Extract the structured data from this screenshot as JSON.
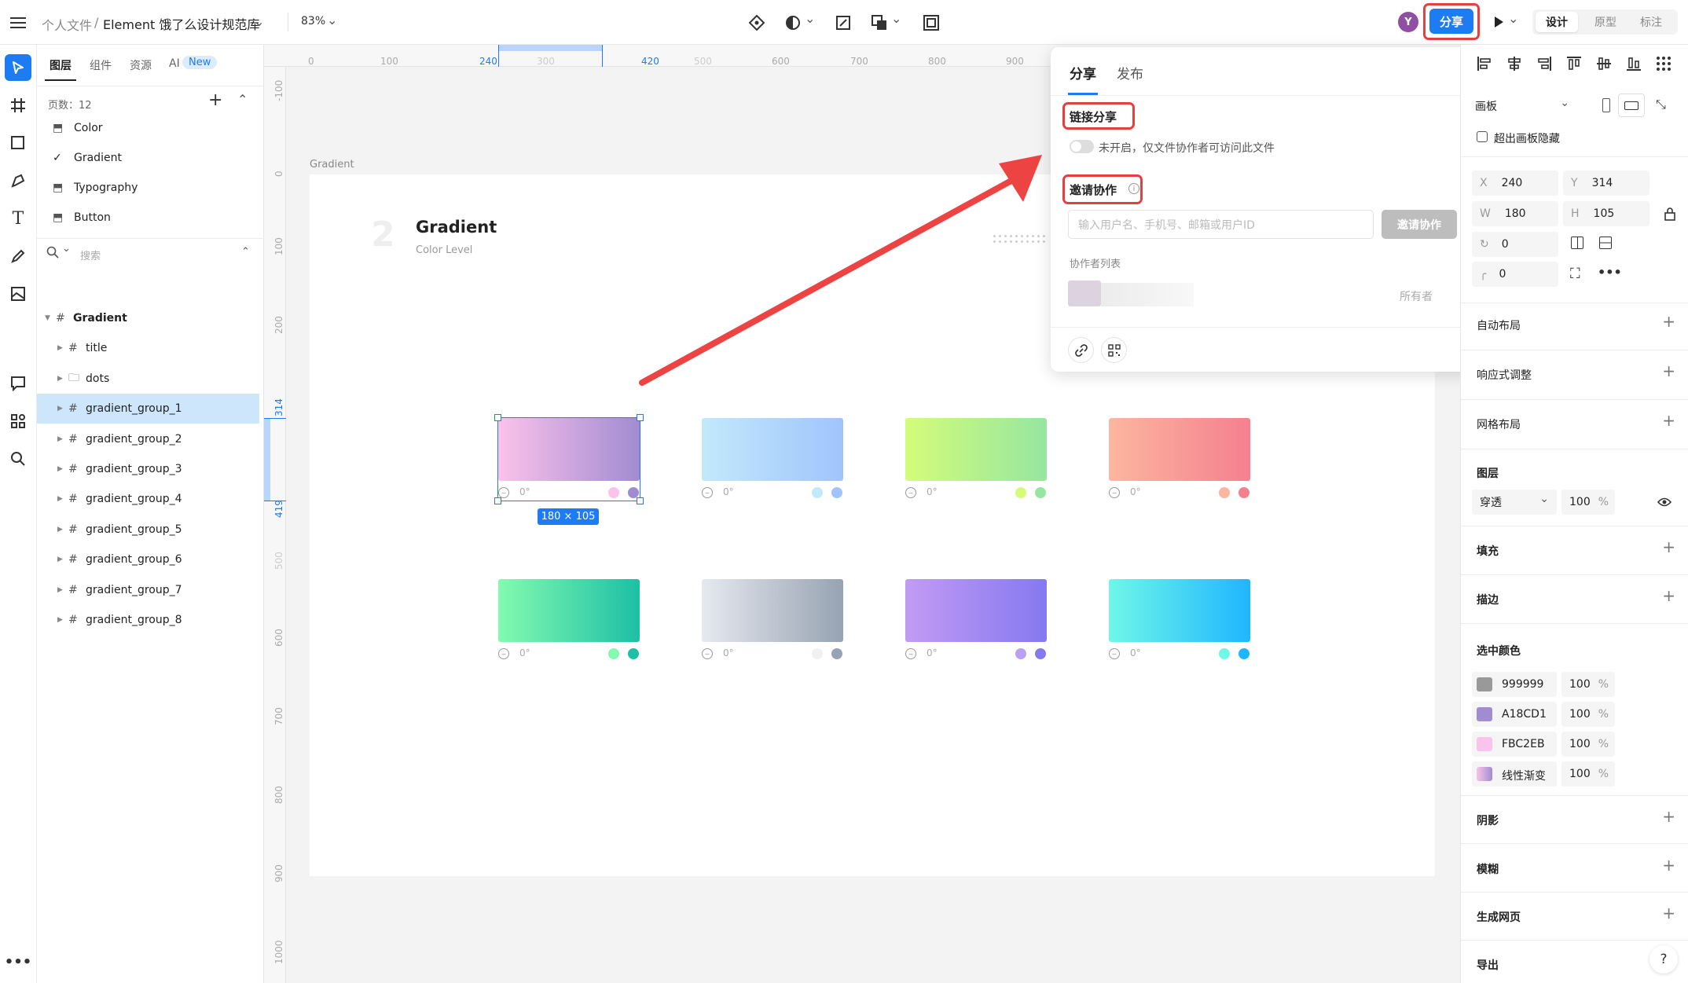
{
  "topbar": {
    "menu_icon": "menu-icon",
    "breadcrumb_parent": "个人文件",
    "breadcrumb_sep": "/",
    "file_name": "Element 饿了么设计规范库",
    "zoom": "83%",
    "avatar_letter": "Y",
    "share_label": "分享",
    "modes": [
      "设计",
      "原型",
      "标注"
    ]
  },
  "layers_panel": {
    "tabs": [
      "图层",
      "组件",
      "资源",
      "AI"
    ],
    "ai_badge": "New",
    "page_count": "页数：12",
    "pages": [
      "Color",
      "Gradient",
      "Typography",
      "Button"
    ],
    "current_page": "Gradient",
    "search_placeholder": "搜索",
    "tree": [
      {
        "name": "Gradient",
        "level": 0,
        "type": "frame"
      },
      {
        "name": "title",
        "level": 1,
        "type": "frame"
      },
      {
        "name": "dots",
        "level": 1,
        "type": "folder"
      },
      {
        "name": "gradient_group_1",
        "level": 1,
        "type": "frame",
        "selected": true
      },
      {
        "name": "gradient_group_2",
        "level": 1,
        "type": "frame"
      },
      {
        "name": "gradient_group_3",
        "level": 1,
        "type": "frame"
      },
      {
        "name": "gradient_group_4",
        "level": 1,
        "type": "frame"
      },
      {
        "name": "gradient_group_5",
        "level": 1,
        "type": "frame"
      },
      {
        "name": "gradient_group_6",
        "level": 1,
        "type": "frame"
      },
      {
        "name": "gradient_group_7",
        "level": 1,
        "type": "frame"
      },
      {
        "name": "gradient_group_8",
        "level": 1,
        "type": "frame"
      }
    ]
  },
  "canvas": {
    "h_ruler": [
      "0",
      "100",
      "240",
      "300",
      "420",
      "500",
      "600",
      "700",
      "800",
      "900"
    ],
    "v_ruler": [
      "-100",
      "0",
      "100",
      "200",
      "314",
      "419",
      "500",
      "600",
      "700",
      "800",
      "900",
      "1000"
    ],
    "frame_label": "Gradient",
    "section_number": "2",
    "section_title": "Gradient",
    "section_subtitle": "Color Level",
    "selection_size": "180 × 105",
    "degree": "0°",
    "gradients": [
      {
        "from": "#FBC2EB",
        "to": "#A18CD1",
        "dot1": "#FBC2EB",
        "dot2": "#A18CD1"
      },
      {
        "from": "#C2E9FB",
        "to": "#A1C4FD",
        "dot1": "#C2E9FB",
        "dot2": "#A1C4FD"
      },
      {
        "from": "#D4FC79",
        "to": "#96E6A1",
        "dot1": "#D4FC79",
        "dot2": "#96E6A1"
      },
      {
        "from": "#FCB69F",
        "to": "#F5808F",
        "dot1": "#FCB69F",
        "dot2": "#F5808F"
      },
      {
        "from": "#84FAB0",
        "to": "#1DBFA6",
        "dot1": "#84FAB0",
        "dot2": "#1DBFA6"
      },
      {
        "from": "#E6E9F0",
        "to": "#97A3B2",
        "dot1": "#F0F0F0",
        "dot2": "#97A3B2"
      },
      {
        "from": "#C29BF3",
        "to": "#8579F0",
        "dot1": "#B9A0F2",
        "dot2": "#8579F0"
      },
      {
        "from": "#6FF7E8",
        "to": "#1FB6FF",
        "dot1": "#6FF7E8",
        "dot2": "#1FB6FF"
      }
    ]
  },
  "share_popup": {
    "tabs": [
      "分享",
      "发布"
    ],
    "link_share_title": "链接分享",
    "link_share_desc": "未开启，仅文件协作者可访问此文件",
    "invite_title": "邀请协作",
    "invite_placeholder": "输入用户名、手机号、邮箱或用户ID",
    "invite_button": "邀请协作",
    "collaborators_label": "协作者列表",
    "owner_label": "所有者"
  },
  "right_panel": {
    "frame_label": "画板",
    "clip_label": "超出画板隐藏",
    "x_label": "X",
    "x": "240",
    "y_label": "Y",
    "y": "314",
    "w_label": "W",
    "w": "180",
    "h_label": "H",
    "h": "105",
    "rotation": "0",
    "radius": "0",
    "sections": [
      "自动布局",
      "响应式调整",
      "网格布局"
    ],
    "layer_title": "图层",
    "blend_mode": "穿透",
    "opacity": "100",
    "percent": "%",
    "fill_title": "填充",
    "stroke_title": "描边",
    "selected_colors_title": "选中颜色",
    "selected_colors": [
      {
        "name": "999999",
        "color": "#999999",
        "opacity": "100"
      },
      {
        "name": "A18CD1",
        "color": "#A18CD1",
        "opacity": "100"
      },
      {
        "name": "FBC2EB",
        "color": "#FBC2EB",
        "opacity": "100"
      },
      {
        "name": "线性渐变",
        "color": "linear",
        "opacity": "100"
      }
    ],
    "bottom_sections": [
      "阴影",
      "模糊",
      "生成网页",
      "导出"
    ],
    "help": "?"
  }
}
